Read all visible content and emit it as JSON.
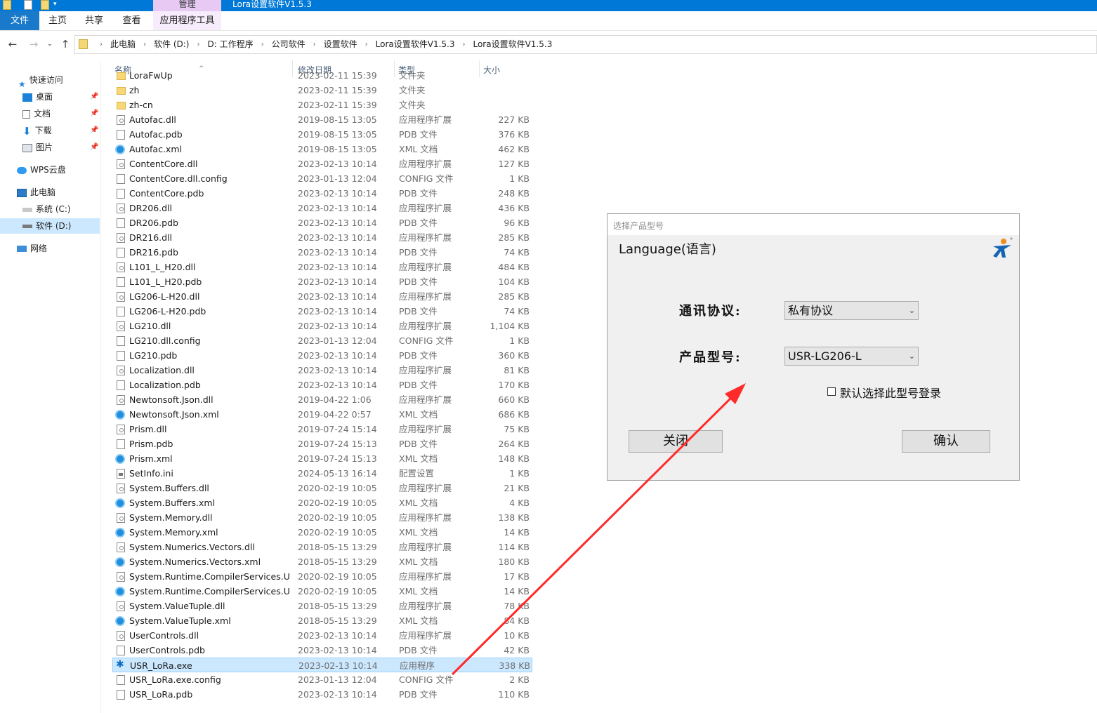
{
  "window": {
    "title": "Lora设置软件V1.5.3",
    "manage_tab": "管理"
  },
  "ribbon": {
    "tabs": [
      "文件",
      "主页",
      "共享",
      "查看",
      "应用程序工具"
    ]
  },
  "breadcrumbs": [
    "此电脑",
    "软件 (D:)",
    "D: 工作程序",
    "公司软件",
    "设置软件",
    "Lora设置软件V1.5.3",
    "Lora设置软件V1.5.3"
  ],
  "sidebar": {
    "quick_access": "快速访问",
    "items": [
      {
        "label": "桌面",
        "icon": "desktop-icon",
        "pinned": true
      },
      {
        "label": "文档",
        "icon": "documents-icon",
        "pinned": true
      },
      {
        "label": "下载",
        "icon": "download-icon",
        "pinned": true
      },
      {
        "label": "图片",
        "icon": "pictures-icon",
        "pinned": true
      }
    ],
    "wps": "WPS云盘",
    "this_pc": "此电脑",
    "drives": [
      {
        "label": "系统 (C:)",
        "icon": "drive-icon"
      },
      {
        "label": "软件 (D:)",
        "icon": "drive-icon",
        "active": true
      }
    ],
    "network": "网络"
  },
  "columns": {
    "name": "名称",
    "date": "修改日期",
    "type": "类型",
    "size": "大小"
  },
  "files": [
    {
      "name": "LoraFwUp",
      "date": "2023-02-11 15:39",
      "type": "文件夹",
      "size": "",
      "icon": "folder"
    },
    {
      "name": "zh",
      "date": "2023-02-11 15:39",
      "type": "文件夹",
      "size": "",
      "icon": "folder"
    },
    {
      "name": "zh-cn",
      "date": "2023-02-11 15:39",
      "type": "文件夹",
      "size": "",
      "icon": "folder"
    },
    {
      "name": "Autofac.dll",
      "date": "2019-08-15 13:05",
      "type": "应用程序扩展",
      "size": "227 KB",
      "icon": "dll"
    },
    {
      "name": "Autofac.pdb",
      "date": "2019-08-15 13:05",
      "type": "PDB 文件",
      "size": "376 KB",
      "icon": "file"
    },
    {
      "name": "Autofac.xml",
      "date": "2019-08-15 13:05",
      "type": "XML 文档",
      "size": "462 KB",
      "icon": "xml"
    },
    {
      "name": "ContentCore.dll",
      "date": "2023-02-13 10:14",
      "type": "应用程序扩展",
      "size": "127 KB",
      "icon": "dll"
    },
    {
      "name": "ContentCore.dll.config",
      "date": "2023-01-13 12:04",
      "type": "CONFIG 文件",
      "size": "1 KB",
      "icon": "file"
    },
    {
      "name": "ContentCore.pdb",
      "date": "2023-02-13 10:14",
      "type": "PDB 文件",
      "size": "248 KB",
      "icon": "file"
    },
    {
      "name": "DR206.dll",
      "date": "2023-02-13 10:14",
      "type": "应用程序扩展",
      "size": "436 KB",
      "icon": "dll"
    },
    {
      "name": "DR206.pdb",
      "date": "2023-02-13 10:14",
      "type": "PDB 文件",
      "size": "96 KB",
      "icon": "file"
    },
    {
      "name": "DR216.dll",
      "date": "2023-02-13 10:14",
      "type": "应用程序扩展",
      "size": "285 KB",
      "icon": "dll"
    },
    {
      "name": "DR216.pdb",
      "date": "2023-02-13 10:14",
      "type": "PDB 文件",
      "size": "74 KB",
      "icon": "file"
    },
    {
      "name": "L101_L_H20.dll",
      "date": "2023-02-13 10:14",
      "type": "应用程序扩展",
      "size": "484 KB",
      "icon": "dll"
    },
    {
      "name": "L101_L_H20.pdb",
      "date": "2023-02-13 10:14",
      "type": "PDB 文件",
      "size": "104 KB",
      "icon": "file"
    },
    {
      "name": "LG206-L-H20.dll",
      "date": "2023-02-13 10:14",
      "type": "应用程序扩展",
      "size": "285 KB",
      "icon": "dll"
    },
    {
      "name": "LG206-L-H20.pdb",
      "date": "2023-02-13 10:14",
      "type": "PDB 文件",
      "size": "74 KB",
      "icon": "file"
    },
    {
      "name": "LG210.dll",
      "date": "2023-02-13 10:14",
      "type": "应用程序扩展",
      "size": "1,104 KB",
      "icon": "dll"
    },
    {
      "name": "LG210.dll.config",
      "date": "2023-01-13 12:04",
      "type": "CONFIG 文件",
      "size": "1 KB",
      "icon": "file"
    },
    {
      "name": "LG210.pdb",
      "date": "2023-02-13 10:14",
      "type": "PDB 文件",
      "size": "360 KB",
      "icon": "file"
    },
    {
      "name": "Localization.dll",
      "date": "2023-02-13 10:14",
      "type": "应用程序扩展",
      "size": "81 KB",
      "icon": "dll"
    },
    {
      "name": "Localization.pdb",
      "date": "2023-02-13 10:14",
      "type": "PDB 文件",
      "size": "170 KB",
      "icon": "file"
    },
    {
      "name": "Newtonsoft.Json.dll",
      "date": "2019-04-22 1:06",
      "type": "应用程序扩展",
      "size": "660 KB",
      "icon": "dll"
    },
    {
      "name": "Newtonsoft.Json.xml",
      "date": "2019-04-22 0:57",
      "type": "XML 文档",
      "size": "686 KB",
      "icon": "xml"
    },
    {
      "name": "Prism.dll",
      "date": "2019-07-24 15:14",
      "type": "应用程序扩展",
      "size": "75 KB",
      "icon": "dll"
    },
    {
      "name": "Prism.pdb",
      "date": "2019-07-24 15:13",
      "type": "PDB 文件",
      "size": "264 KB",
      "icon": "file"
    },
    {
      "name": "Prism.xml",
      "date": "2019-07-24 15:13",
      "type": "XML 文档",
      "size": "148 KB",
      "icon": "xml"
    },
    {
      "name": "SetInfo.ini",
      "date": "2024-05-13 16:14",
      "type": "配置设置",
      "size": "1 KB",
      "icon": "ini"
    },
    {
      "name": "System.Buffers.dll",
      "date": "2020-02-19 10:05",
      "type": "应用程序扩展",
      "size": "21 KB",
      "icon": "dll"
    },
    {
      "name": "System.Buffers.xml",
      "date": "2020-02-19 10:05",
      "type": "XML 文档",
      "size": "4 KB",
      "icon": "xml"
    },
    {
      "name": "System.Memory.dll",
      "date": "2020-02-19 10:05",
      "type": "应用程序扩展",
      "size": "138 KB",
      "icon": "dll"
    },
    {
      "name": "System.Memory.xml",
      "date": "2020-02-19 10:05",
      "type": "XML 文档",
      "size": "14 KB",
      "icon": "xml"
    },
    {
      "name": "System.Numerics.Vectors.dll",
      "date": "2018-05-15 13:29",
      "type": "应用程序扩展",
      "size": "114 KB",
      "icon": "dll"
    },
    {
      "name": "System.Numerics.Vectors.xml",
      "date": "2018-05-15 13:29",
      "type": "XML 文档",
      "size": "180 KB",
      "icon": "xml"
    },
    {
      "name": "System.Runtime.CompilerServices.Un...",
      "date": "2020-02-19 10:05",
      "type": "应用程序扩展",
      "size": "17 KB",
      "icon": "dll"
    },
    {
      "name": "System.Runtime.CompilerServices.Un...",
      "date": "2020-02-19 10:05",
      "type": "XML 文档",
      "size": "14 KB",
      "icon": "xml"
    },
    {
      "name": "System.ValueTuple.dll",
      "date": "2018-05-15 13:29",
      "type": "应用程序扩展",
      "size": "78 KB",
      "icon": "dll"
    },
    {
      "name": "System.ValueTuple.xml",
      "date": "2018-05-15 13:29",
      "type": "XML 文档",
      "size": "84 KB",
      "icon": "xml"
    },
    {
      "name": "UserControls.dll",
      "date": "2023-02-13 10:14",
      "type": "应用程序扩展",
      "size": "10 KB",
      "icon": "dll"
    },
    {
      "name": "UserControls.pdb",
      "date": "2023-02-13 10:14",
      "type": "PDB 文件",
      "size": "42 KB",
      "icon": "file"
    },
    {
      "name": "USR_LoRa.exe",
      "date": "2023-02-13 10:14",
      "type": "应用程序",
      "size": "338 KB",
      "icon": "exe",
      "selected": true
    },
    {
      "name": "USR_LoRa.exe.config",
      "date": "2023-01-13 12:04",
      "type": "CONFIG 文件",
      "size": "2 KB",
      "icon": "file"
    },
    {
      "name": "USR_LoRa.pdb",
      "date": "2023-02-13 10:14",
      "type": "PDB 文件",
      "size": "110 KB",
      "icon": "file"
    }
  ],
  "dialog": {
    "title": "选择产品型号",
    "language": "Language(语言)",
    "protocol_label": "通讯协议:",
    "protocol_value": "私有协议",
    "model_label": "产品型号:",
    "model_value": "USR-LG206-L",
    "remember_label": "默认选择此型号登录",
    "remember_checked": false,
    "close_button": "关闭",
    "ok_button": "确认"
  },
  "colors": {
    "accent": "#0078d7",
    "selection": "#cce8ff",
    "annotation_arrow": "#ff2a2a"
  }
}
